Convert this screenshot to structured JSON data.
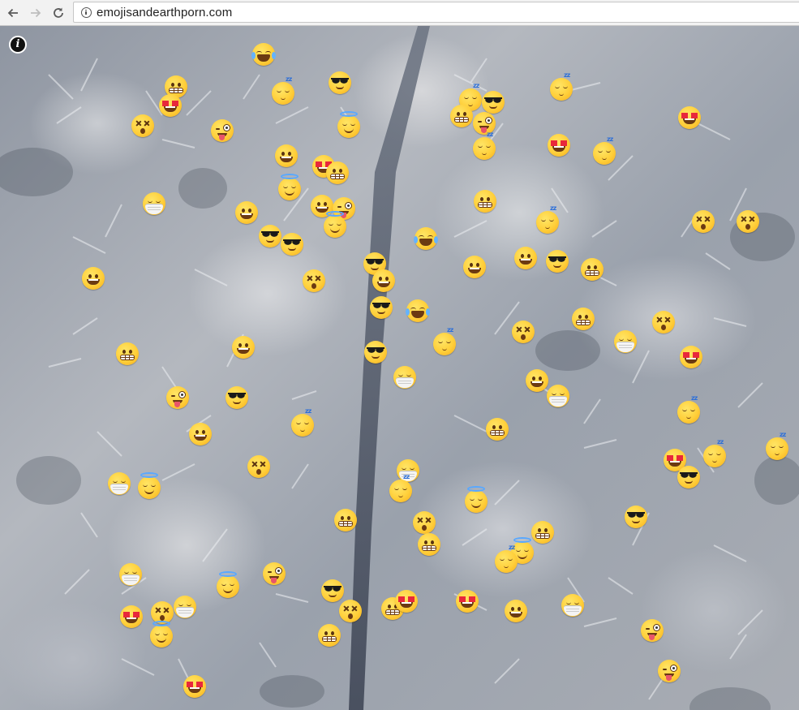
{
  "browser": {
    "url": "emojisandearthporn.com",
    "back_icon": "arrow-left-icon",
    "forward_icon": "arrow-right-icon",
    "reload_icon": "reload-icon",
    "site_info_icon": "info-icon"
  },
  "page": {
    "info_button_label": "i",
    "background": "aerial photo of snow-covered pine forest with a road"
  },
  "emoji_types": {
    "grin": "grinning-face",
    "grit": "grimacing-face",
    "cool": "sunglasses-face",
    "hearts": "heart-eyes-face",
    "dizzy": "dizzy-face",
    "sleepy": "sleeping-face",
    "joy": "tears-of-joy-face",
    "angel": "halo-face",
    "mask": "medical-mask-face",
    "crazy": "zany-face"
  }
}
